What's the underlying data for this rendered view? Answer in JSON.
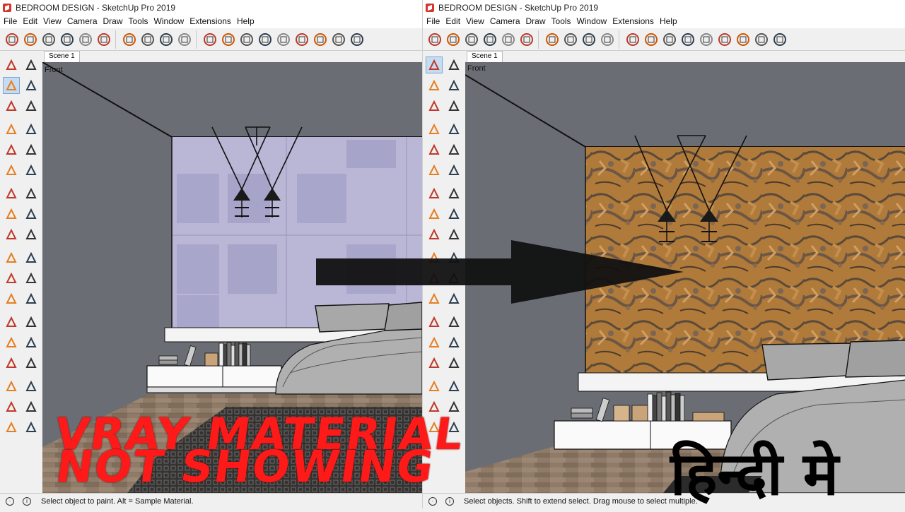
{
  "left_window": {
    "title": "BEDROOM DESIGN - SketchUp Pro 2019",
    "menu": [
      "File",
      "Edit",
      "View",
      "Camera",
      "Draw",
      "Tools",
      "Window",
      "Extensions",
      "Help"
    ],
    "scene_tab": "Scene 1",
    "view_label": "Front",
    "status_text": "Select object to paint. Alt = Sample Material.",
    "active_tool": "paint-bucket"
  },
  "right_window": {
    "title": "BEDROOM DESIGN - SketchUp Pro 2019",
    "menu": [
      "File",
      "Edit",
      "View",
      "Camera",
      "Draw",
      "Tools",
      "Window",
      "Extensions",
      "Help"
    ],
    "scene_tab": "Scene 1",
    "view_label": "Front",
    "status_text": "Select objects. Shift to extend select. Drag mouse to select multiple.",
    "active_tool": "select"
  },
  "overlay": {
    "line1": "VRAY MATERIAL",
    "line2": "NOT SHOWING",
    "hindi": "हिन्दी मे"
  },
  "colors": {
    "overlay_red": "#ff1a1a",
    "wall_left": "#b9b6d6",
    "wall_right": "#b07a3a",
    "back_wall": "#6a6e74",
    "floor": "#8a7866"
  },
  "toolbar_icons": [
    "instructor-icon",
    "teapot-icon",
    "hand-teapot-icon",
    "cloud-icon",
    "sync-icon",
    "teapot-print-icon",
    "screen-icon",
    "window-icon",
    "window-cloud-icon",
    "window-lock-icon",
    "light-grid-icon",
    "sun-icon",
    "omni-light-icon",
    "spot-light-icon",
    "ies-light-icon",
    "mesh-light-icon",
    "sphere-icon",
    "dome-light-icon",
    "clipper-icon"
  ],
  "left_tools": [
    "select-icon",
    "component-icon",
    "paint-bucket-icon",
    "eraser-icon",
    "pencil-icon",
    "freehand-icon",
    "rectangle-icon",
    "rotated-rectangle-icon",
    "circle-icon",
    "polygon-icon",
    "arc-icon",
    "2pt-arc-icon",
    "3pt-arc-icon",
    "pie-icon",
    "move-icon",
    "push-pull-icon",
    "rotate-icon",
    "follow-me-icon",
    "scale-icon",
    "offset-icon",
    "tape-measure-icon",
    "dimension-icon",
    "protractor-icon",
    "text-icon",
    "axes-icon",
    "3d-text-icon",
    "orbit-icon",
    "pan-icon",
    "zoom-icon",
    "zoom-window-icon",
    "zoom-extents-icon",
    "previous-icon",
    "position-camera-icon",
    "look-around-icon",
    "walk-icon",
    "section-plane-icon"
  ]
}
